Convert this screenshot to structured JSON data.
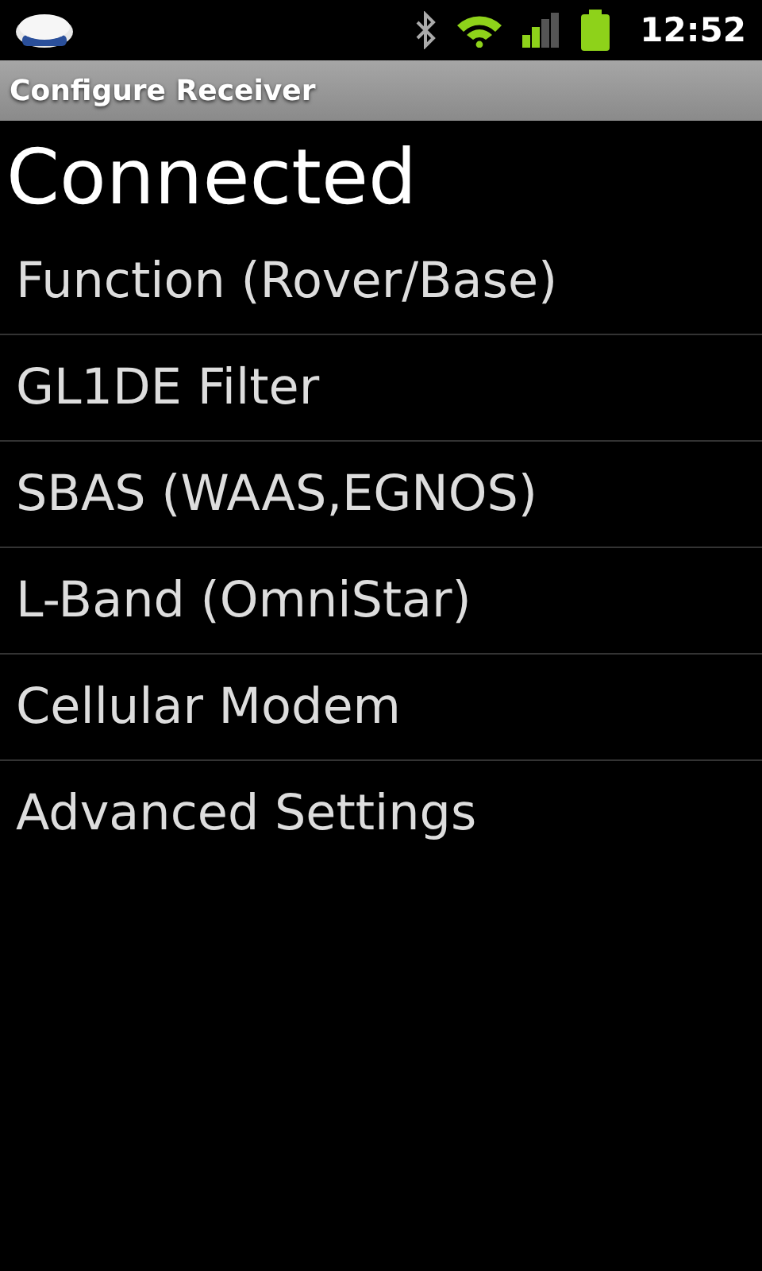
{
  "status_bar": {
    "time": "12:52"
  },
  "window": {
    "title": "Configure Receiver"
  },
  "status": {
    "text": "Connected"
  },
  "menu": [
    {
      "label": "Function (Rover/Base)"
    },
    {
      "label": "GL1DE Filter"
    },
    {
      "label": "SBAS (WAAS,EGNOS)"
    },
    {
      "label": "L-Band (OmniStar)"
    },
    {
      "label": "Cellular Modem"
    },
    {
      "label": "Advanced Settings"
    }
  ]
}
